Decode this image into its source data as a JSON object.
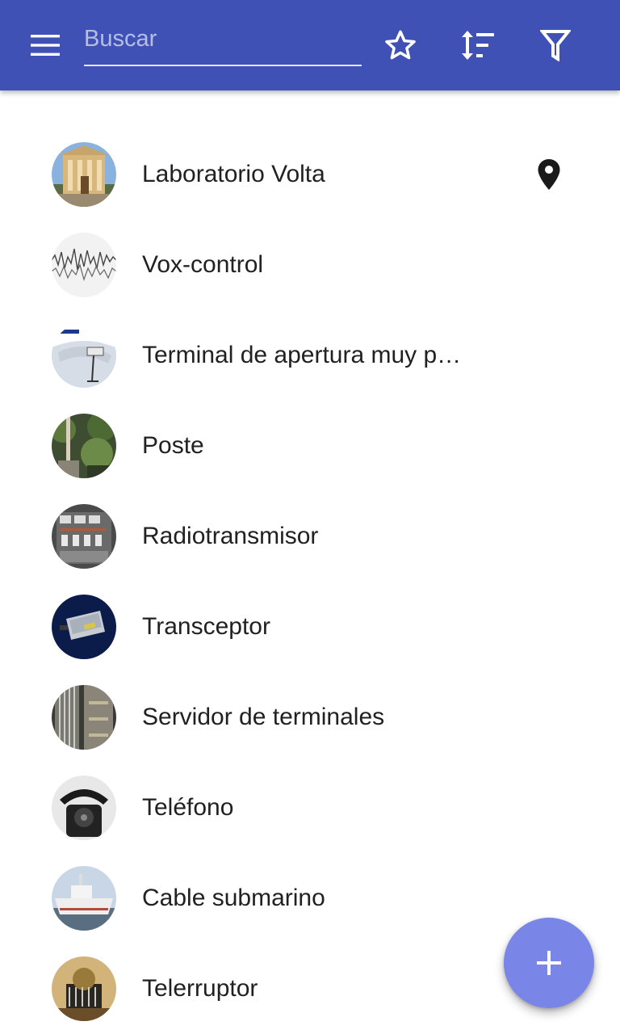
{
  "toolbar": {
    "menu_icon": "menu-icon",
    "search_placeholder": "Buscar",
    "search_value": "",
    "favorites_icon": "star-outline-icon",
    "sort_icon": "sort-icon",
    "filter_icon": "filter-icon",
    "background_color": "#3f51b5"
  },
  "list": {
    "items": [
      {
        "label": "Laboratorio Volta",
        "has_location": true,
        "location_icon": "map-pin-icon"
      },
      {
        "label": "Vox-control"
      },
      {
        "label": "Terminal de apertura muy p…"
      },
      {
        "label": "Poste"
      },
      {
        "label": "Radiotransmisor"
      },
      {
        "label": "Transceptor"
      },
      {
        "label": "Servidor de terminales"
      },
      {
        "label": "Teléfono"
      },
      {
        "label": "Cable submarino"
      },
      {
        "label": "Telerruptor"
      }
    ]
  },
  "fab": {
    "icon": "plus-icon",
    "color": "#7986e8"
  }
}
